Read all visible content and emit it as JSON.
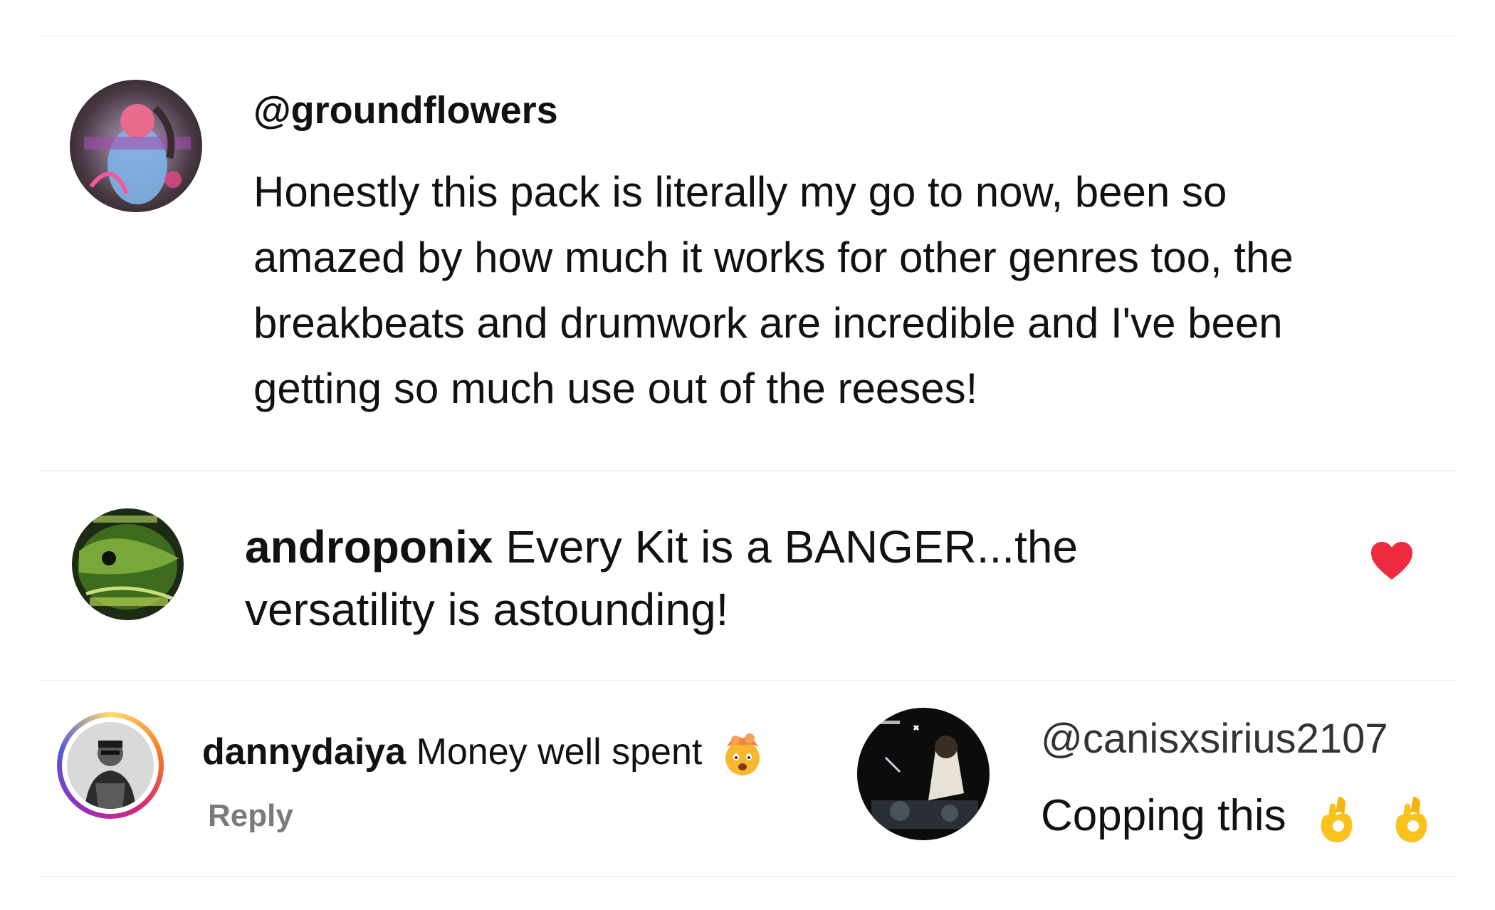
{
  "comments": [
    {
      "handle": "@groundflowers",
      "lines": [
        "Honestly this pack is literally my go to now, been so",
        "amazed by how much it works for other genres too, the",
        "breakbeats and drumwork are incredible and I've been",
        "getting so much use out of the reeses!"
      ]
    },
    {
      "handle": "androponix",
      "text_line1": "Every Kit is a BANGER...the",
      "text_line2": "versatility is astounding!",
      "liked": true,
      "heart_color": "#ee2a3f"
    },
    {
      "handle": "dannydaiya",
      "text": "Money well spent",
      "emoji": "exploding-head-emoji",
      "reply_label": "Reply",
      "story_ring_colors": [
        "#feda75",
        "#fa7e1e",
        "#d62976",
        "#962fbf"
      ]
    },
    {
      "handle": "@canisxsirius2107",
      "text": "Copping this",
      "emojis": [
        "ok-hand-emoji",
        "ok-hand-emoji"
      ]
    }
  ],
  "colors": {
    "text": "#111111",
    "muted": "#7a7a7a",
    "divider": "#f2f2f2"
  }
}
